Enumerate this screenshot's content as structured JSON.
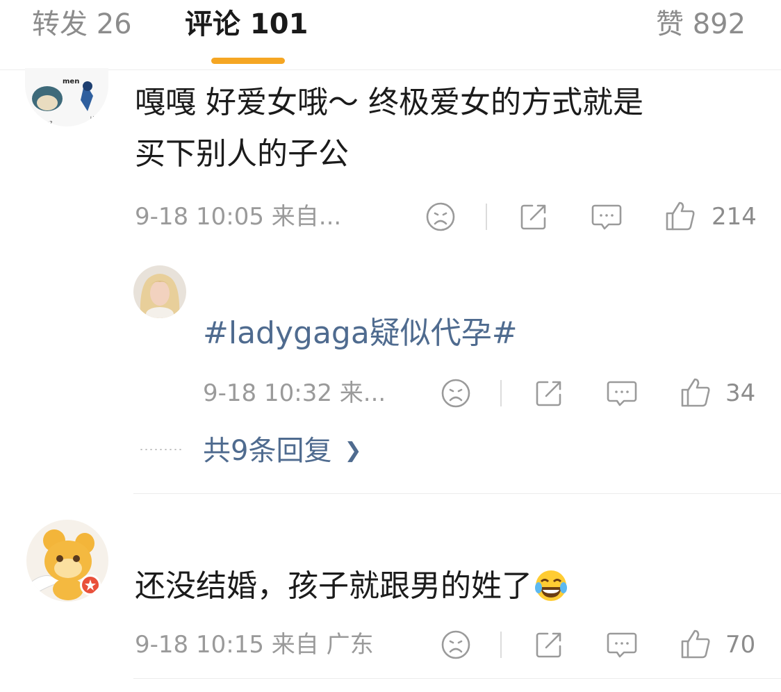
{
  "tabs": [
    {
      "label": "转发 26",
      "active": false
    },
    {
      "label": "评论 101",
      "active": true
    },
    {
      "label": "赞 892",
      "active": false
    }
  ],
  "colors": {
    "accent": "#f5a623",
    "topic": "#4f6b8f",
    "meta": "#9a9a9a"
  },
  "comments": [
    {
      "avatar": "snorlax-lucario-meme-avatar",
      "avatar_text": [
        "men",
        "bro?",
        "I know"
      ],
      "text_lines": [
        "嘎嘎 好爱女哦～ 终极爱女的方式就是",
        "买下别人的子公"
      ],
      "meta": "9-18 10:05  来自...",
      "likes": "214",
      "reply": {
        "avatar": "blonde-woman-avatar",
        "text": "#ladygaga疑似代孕#",
        "meta": "9-18 10:32  来...",
        "likes": "34"
      },
      "more_replies": "共9条回复"
    },
    {
      "avatar": "cartoon-bear-avatar",
      "text": "还没结婚，孩子就跟男的姓了",
      "meta": "9-18 10:15  来自 广东",
      "likes": "70"
    }
  ],
  "icons": {
    "sad": "sad-face-icon",
    "share": "share-icon",
    "comment": "comment-icon",
    "like": "thumbs-up-icon",
    "emoji": "laughing-tears-emoji"
  }
}
